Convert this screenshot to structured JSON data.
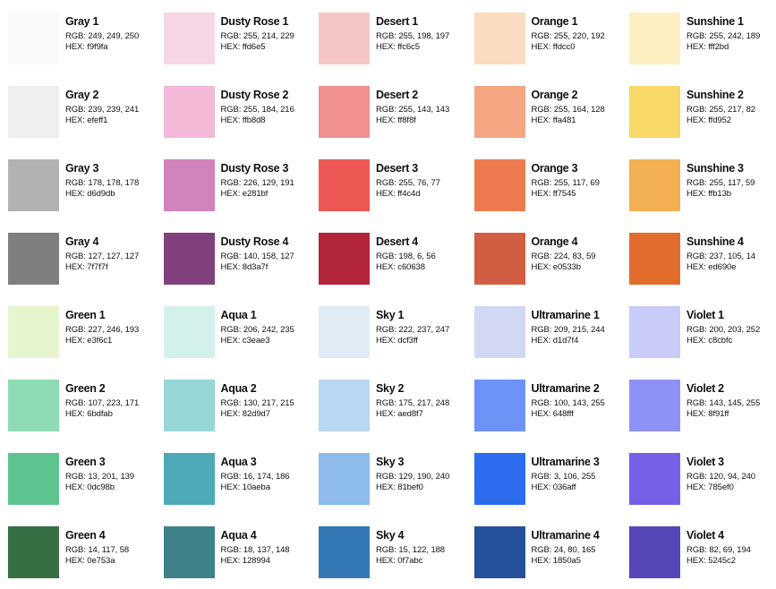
{
  "palette": [
    {
      "name": "Gray 1",
      "rgb": "RGB: 249, 249, 250",
      "hex": "HEX: f9f9fa",
      "color": "#f9f9fa"
    },
    {
      "name": "Dusty Rose 1",
      "rgb": "RGB: 255, 214, 229",
      "hex": "HEX: ffd6e5",
      "color": "#f7d6e5"
    },
    {
      "name": "Desert 1",
      "rgb": "RGB: 255, 198, 197",
      "hex": "HEX: ffc6c5",
      "color": "#f6c6c5"
    },
    {
      "name": "Orange 1",
      "rgb": "RGB: 255, 220, 192",
      "hex": "HEX: ffdcc0",
      "color": "#fbdcc0"
    },
    {
      "name": "Sunshine 1",
      "rgb": "RGB: 255, 242, 189",
      "hex": "HEX: fff2bd",
      "color": "#fcf0c2"
    },
    {
      "name": "Gray 2",
      "rgb": "RGB: 239, 239, 241",
      "hex": "HEX: efeff1",
      "color": "#efeff1"
    },
    {
      "name": "Dusty Rose 2",
      "rgb": "RGB: 255, 184, 216",
      "hex": "HEX: ffb8d8",
      "color": "#f3b9d6"
    },
    {
      "name": "Desert 2",
      "rgb": "RGB: 255, 143, 143",
      "hex": "HEX: ff8f8f",
      "color": "#f0908f"
    },
    {
      "name": "Orange 2",
      "rgb": "RGB: 255, 164, 128",
      "hex": "HEX: ffa481",
      "color": "#f4a682"
    },
    {
      "name": "Sunshine 2",
      "rgb": "RGB: 255, 217, 82",
      "hex": "HEX: ffd952",
      "color": "#f8d866"
    },
    {
      "name": "Gray 3",
      "rgb": "RGB: 178, 178, 178",
      "hex": "HEX: d6d9db",
      "color": "#b2b2b2"
    },
    {
      "name": "Dusty Rose 3",
      "rgb": "RGB: 226, 129, 191",
      "hex": "HEX: e281bf",
      "color": "#d383bc"
    },
    {
      "name": "Desert 3",
      "rgb": "RGB: 255, 76, 77",
      "hex": "HEX: ff4c4d",
      "color": "#ec5754"
    },
    {
      "name": "Orange 3",
      "rgb": "RGB: 255, 117, 69",
      "hex": "HEX: ff7545",
      "color": "#ee7b50"
    },
    {
      "name": "Sunshine 3",
      "rgb": "RGB: 255, 117, 59",
      "hex": "HEX: ffb13b",
      "color": "#f3b052"
    },
    {
      "name": "Gray 4",
      "rgb": "RGB: 127, 127, 127",
      "hex": "HEX: 7f7f7f",
      "color": "#7f7f7f"
    },
    {
      "name": "Dusty Rose 4",
      "rgb": "RGB: 140, 158, 127",
      "hex": "HEX: 8d3a7f",
      "color": "#803f7d"
    },
    {
      "name": "Desert 4",
      "rgb": "RGB: 198, 6, 56",
      "hex": "HEX: c60638",
      "color": "#b2253a"
    },
    {
      "name": "Orange 4",
      "rgb": "RGB: 224, 83, 59",
      "hex": "HEX: e0533b",
      "color": "#d15d42"
    },
    {
      "name": "Sunshine 4",
      "rgb": "RGB: 237, 105, 14",
      "hex": "HEX: ed690e",
      "color": "#e06d2c"
    },
    {
      "name": "Green 1",
      "rgb": "RGB: 227, 246, 193",
      "hex": "HEX: e3f6c1",
      "color": "#e6f5cd"
    },
    {
      "name": "Aqua 1",
      "rgb": "RGB: 206, 242, 235",
      "hex": "HEX: c3eae3",
      "color": "#d4f0eb"
    },
    {
      "name": "Sky 1",
      "rgb": "RGB: 222, 237, 247",
      "hex": "HEX: dcf3ff",
      "color": "#dfecf6"
    },
    {
      "name": "Ultramarine 1",
      "rgb": "RGB: 209, 215, 244",
      "hex": "HEX: d1d7f4",
      "color": "#d2d7f2"
    },
    {
      "name": "Violet 1",
      "rgb": "RGB: 200, 203, 252",
      "hex": "HEX: c8cbfc",
      "color": "#c9ccf8"
    },
    {
      "name": "Green 2",
      "rgb": "RGB: 107, 223, 171",
      "hex": "HEX: 6bdfab",
      "color": "#8ddcb3"
    },
    {
      "name": "Aqua 2",
      "rgb": "RGB: 130, 217, 215",
      "hex": "HEX: 82d9d7",
      "color": "#98d7d8"
    },
    {
      "name": "Sky 2",
      "rgb": "RGB: 175, 217, 248",
      "hex": "HEX: aed8f7",
      "color": "#b7d7f2"
    },
    {
      "name": "Ultramarine 2",
      "rgb": "RGB: 100, 143, 255",
      "hex": "HEX: 648fff",
      "color": "#6d92f8"
    },
    {
      "name": "Violet 2",
      "rgb": "RGB: 143, 145, 255",
      "hex": "HEX: 8f91ff",
      "color": "#8f92f5"
    },
    {
      "name": "Green 3",
      "rgb": "RGB: 13, 201, 139",
      "hex": "HEX: 0dc98b",
      "color": "#5dc491"
    },
    {
      "name": "Aqua 3",
      "rgb": "RGB: 16, 174, 186",
      "hex": "HEX: 10aeba",
      "color": "#4ea9b8"
    },
    {
      "name": "Sky 3",
      "rgb": "RGB: 129, 190, 240",
      "hex": "HEX: 81bef0",
      "color": "#8dbbea"
    },
    {
      "name": "Ultramarine 3",
      "rgb": "RGB: 3, 106, 255",
      "hex": "HEX: 036aff",
      "color": "#2c6df0"
    },
    {
      "name": "Violet 3",
      "rgb": "RGB: 120, 94, 240",
      "hex": "HEX: 785ef0",
      "color": "#7660e8"
    },
    {
      "name": "Green 4",
      "rgb": "RGB: 14, 117, 58",
      "hex": "HEX: 0e753a",
      "color": "#356f43"
    },
    {
      "name": "Aqua 4",
      "rgb": "RGB: 18, 137, 148",
      "hex": "HEX: 128994",
      "color": "#3d8189"
    },
    {
      "name": "Sky 4",
      "rgb": "RGB: 15, 122, 188",
      "hex": "HEX: 0f7abc",
      "color": "#3279b6"
    },
    {
      "name": "Ultramarine 4",
      "rgb": "RGB: 24, 80, 165",
      "hex": "HEX: 1850a5",
      "color": "#24509c"
    },
    {
      "name": "Violet 4",
      "rgb": "RGB: 82, 69, 194",
      "hex": "HEX: 5245c2",
      "color": "#5448b9"
    }
  ]
}
